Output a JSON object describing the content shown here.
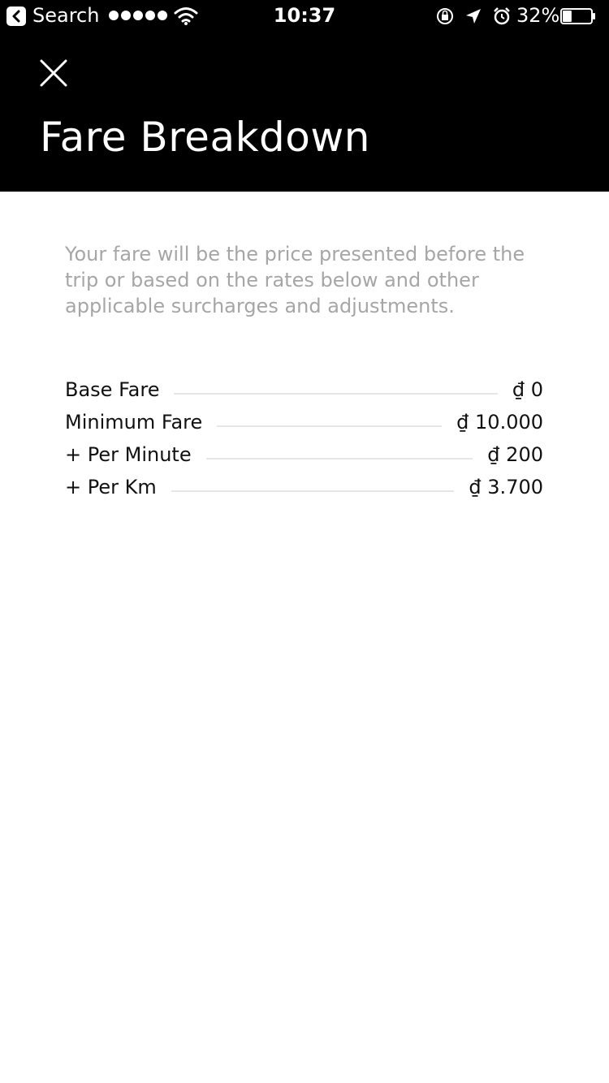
{
  "status_bar": {
    "back_label": "Search",
    "time": "10:37",
    "battery": "32%"
  },
  "header": {
    "title": "Fare Breakdown"
  },
  "intro_text": "Your fare will be the price presented before the trip or based on the rates below and other applicable surcharges and adjustments.",
  "fares": [
    {
      "label": "Base Fare",
      "value": "₫ 0"
    },
    {
      "label": "Minimum Fare",
      "value": "₫ 10.000"
    },
    {
      "label": "+ Per Minute",
      "value": "₫ 200"
    },
    {
      "label": "+ Per Km",
      "value": "₫ 3.700"
    }
  ],
  "battery_level": 0.32
}
